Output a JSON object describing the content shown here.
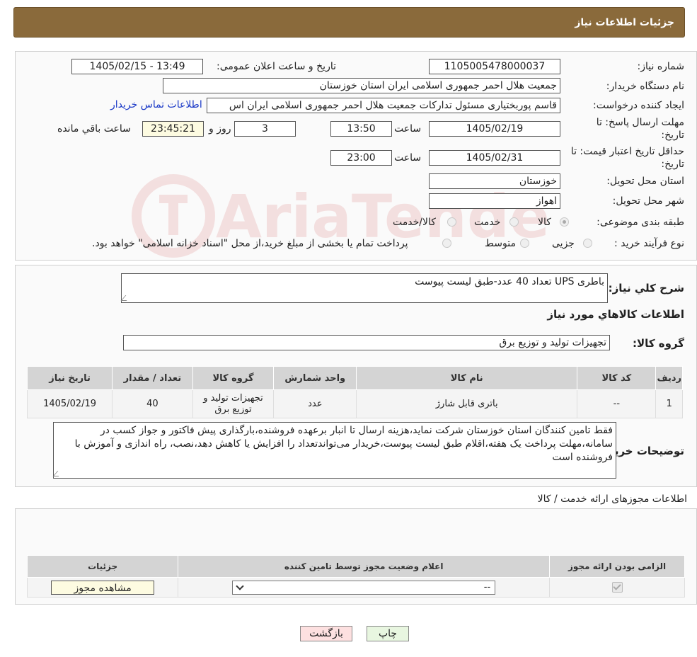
{
  "header": {
    "title": "جزئیات اطلاعات نیاز"
  },
  "form": {
    "need_number_label": "شماره نیاز:",
    "need_number": "1105005478000037",
    "announce_label": "تاریخ و ساعت اعلان عمومی:",
    "announce_value": "1405/02/15 - 13:49",
    "buyer_org_label": "نام دستگاه خریدار:",
    "buyer_org": "جمعیت هلال احمر جمهوری اسلامی ایران استان خوزستان",
    "creator_label": "ایجاد کننده درخواست:",
    "creator": "قاسم پوربختیاری مسئول تدارکات جمعیت هلال احمر جمهوری اسلامی ایران اس",
    "contact_link": "اطلاعات تماس خریدار",
    "deadline_label_1": "مهلت ارسال پاسخ: تا",
    "deadline_label_2": "تاریخ:",
    "deadline_date": "1405/02/19",
    "time_word": "ساعت",
    "deadline_time": "13:50",
    "days_count": "3",
    "day_and_word": "روز و",
    "remaining_time": "23:45:21",
    "remaining_word": "ساعت باقي مانده",
    "validity_label_1": "حداقل تاریخ اعتبار قیمت: تا",
    "validity_label_2": "تاریخ:",
    "validity_date": "1405/02/31",
    "validity_time": "23:00",
    "province_label": "استان محل تحویل:",
    "province": "خوزستان",
    "city_label": "شهر محل تحویل:",
    "city": "اهواز",
    "category_label": "طبقه بندی موضوعی:",
    "category_options": [
      "کالا",
      "خدمت",
      "کالا/خدمت"
    ],
    "process_label": "نوع فرآیند خرید :",
    "process_options": [
      "جزیی",
      "متوسط"
    ],
    "process_note": "پرداخت تمام یا بخشی از مبلغ خرید،از محل \"اسناد خزانه اسلامی\" خواهد بود."
  },
  "summary": {
    "label": "شرح کلي نياز:",
    "value": "باطری UPS تعداد 40 عدد-طبق لیست پیوست",
    "items_heading": "اطلاعات کالاهاي مورد نياز",
    "group_label": "گروه کالا:",
    "group_value": "تجهیزات تولید و توزیع برق"
  },
  "items_table": {
    "headers": [
      "رديف",
      "کد کالا",
      "نام کالا",
      "واحد شمارش",
      "گروه کالا",
      "تعداد / مقدار",
      "تاریخ نیاز"
    ],
    "rows": [
      [
        "1",
        "--",
        "باتری قابل شارژ",
        "عدد",
        "تجهیزات تولید و توزیع برق",
        "40",
        "1405/02/19"
      ]
    ]
  },
  "buyer_notes": {
    "label": "توضیحات خریدار:",
    "text": "فقط تامین کنندگان استان خوزستان شرکت نماید،هزینه ارسال تا انبار برعهده فروشنده،بارگذاری پیش فاکتور و جواز کسب در سامانه،مهلت پرداخت یک هفته،اقلام طبق لیست پیوست،خریدار می‌تواندتعداد را افزایش یا کاهش دهد،نصب، راه اندازی و آموزش با فروشنده است"
  },
  "permits": {
    "title": "اطلاعات مجوزهای ارائه خدمت / کالا",
    "headers": [
      "الزامی بودن ارائه مجوز",
      "اعلام وضعیت مجوز توسط تامین کننده",
      "جزئیات"
    ],
    "select_value": "--",
    "view_button": "مشاهده مجوز"
  },
  "buttons": {
    "print": "چاپ",
    "back": "بازگشت"
  },
  "watermark": {
    "text": "AriaTender.neT"
  },
  "colors": {
    "header_bg": "#8a6a3b",
    "link": "#1a39c7",
    "back_btn": "#fde0e0",
    "print_btn": "#e8f6e0"
  }
}
